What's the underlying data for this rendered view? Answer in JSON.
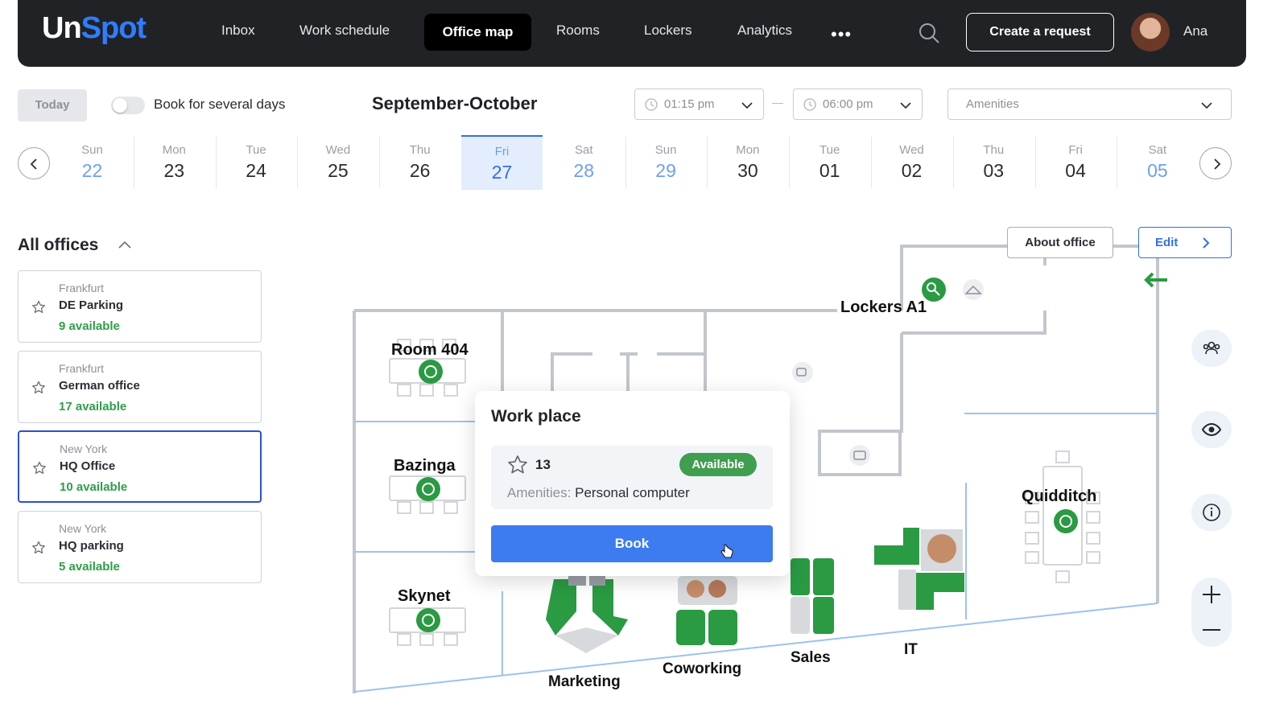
{
  "header": {
    "logo_part1": "Un",
    "logo_part2": "Spot",
    "nav": [
      "Inbox",
      "Work schedule",
      "Office map",
      "Rooms",
      "Lockers",
      "Analytics"
    ],
    "active_nav": "Office map",
    "more": "•••",
    "create_request": "Create a request",
    "user_name": "Ana"
  },
  "toolbar": {
    "today": "Today",
    "several_days": "Book for several days",
    "month": "September-October",
    "time_from": "01:15 pm",
    "time_to": "06:00 pm",
    "amenities_placeholder": "Amenities"
  },
  "days": [
    {
      "name": "Sun",
      "date": "22",
      "weekend": true
    },
    {
      "name": "Mon",
      "date": "23"
    },
    {
      "name": "Tue",
      "date": "24"
    },
    {
      "name": "Wed",
      "date": "25"
    },
    {
      "name": "Thu",
      "date": "26"
    },
    {
      "name": "Fri",
      "date": "27",
      "selected": true
    },
    {
      "name": "Sat",
      "date": "28",
      "weekend": true
    },
    {
      "name": "Sun",
      "date": "29",
      "weekend": true
    },
    {
      "name": "Mon",
      "date": "30"
    },
    {
      "name": "Tue",
      "date": "01"
    },
    {
      "name": "Wed",
      "date": "02"
    },
    {
      "name": "Thu",
      "date": "03"
    },
    {
      "name": "Fri",
      "date": "04"
    },
    {
      "name": "Sat",
      "date": "05",
      "weekend": true
    }
  ],
  "sidebar": {
    "title": "All offices",
    "offices": [
      {
        "city": "Frankfurt",
        "name": "DE Parking",
        "available": "9 available"
      },
      {
        "city": "Frankfurt",
        "name": "German office",
        "available": "17 available"
      },
      {
        "city": "New York",
        "name": "HQ Office",
        "available": "10 available",
        "active": true
      },
      {
        "city": "New York",
        "name": "HQ parking",
        "available": "5 available"
      }
    ]
  },
  "map": {
    "about_office": "About office",
    "edit": "Edit",
    "rooms": [
      "Room 404",
      "Bazinga",
      "Skynet",
      "Quidditch",
      "Lockers A1"
    ],
    "zones": [
      "Marketing",
      "Coworking",
      "Sales",
      "IT"
    ]
  },
  "popup": {
    "title": "Work place",
    "seat_number": "13",
    "status": "Available",
    "amenities_label": "Amenities:",
    "amenities_value": "Personal computer",
    "book": "Book"
  },
  "colors": {
    "brand_blue": "#2f7dff",
    "nav_bg": "#202226",
    "available_green": "#2e9e48",
    "desk_green": "#2a9a43",
    "selected_day": "#2f6ff0",
    "wall": "#c2c6cd",
    "zone_line": "#9cc2ee"
  }
}
